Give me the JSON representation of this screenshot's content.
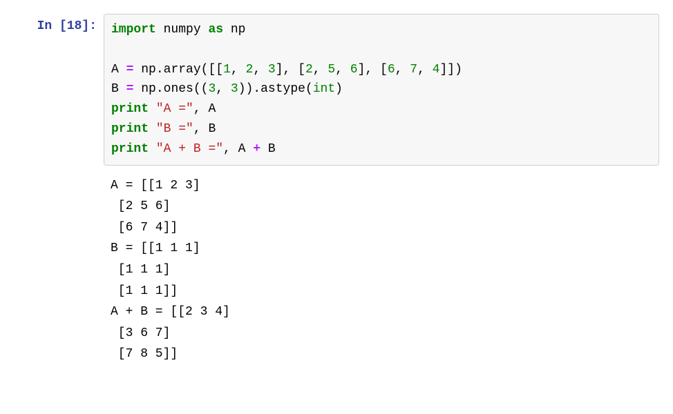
{
  "prompt": {
    "label": "In [18]:"
  },
  "code": {
    "kw_import": "import",
    "mod_numpy": "numpy",
    "kw_as": "as",
    "alias_np": "np",
    "var_A": "A",
    "eq": "=",
    "np_array_call": "np.array([[",
    "n1": "1",
    "comma_sp": ", ",
    "n2": "2",
    "n3": "3",
    "mid_sep": "], [",
    "n2b": "2",
    "n5": "5",
    "n6": "6",
    "n6b": "6",
    "n7": "7",
    "n4": "4",
    "close_array": "]])",
    "var_B": "B",
    "np_ones_open": "np.ones((",
    "n3a": "3",
    "n3b": "3",
    "ones_close": ")).astype(",
    "int_kw": "int",
    "paren_close": ")",
    "kw_print1": "print",
    "str_A": "\"A =\"",
    "ref_A": "A",
    "kw_print2": "print",
    "str_B": "\"B =\"",
    "ref_B": "B",
    "kw_print3": "print",
    "str_ApB": "\"A + B =\"",
    "ref_A2": "A",
    "plus": "+",
    "ref_B2": "B"
  },
  "output": {
    "l1": "A = [[1 2 3]",
    "l2": " [2 5 6]",
    "l3": " [6 7 4]]",
    "l4": "B = [[1 1 1]",
    "l5": " [1 1 1]",
    "l6": " [1 1 1]]",
    "l7": "A + B = [[2 3 4]",
    "l8": " [3 6 7]",
    "l9": " [7 8 5]]"
  }
}
